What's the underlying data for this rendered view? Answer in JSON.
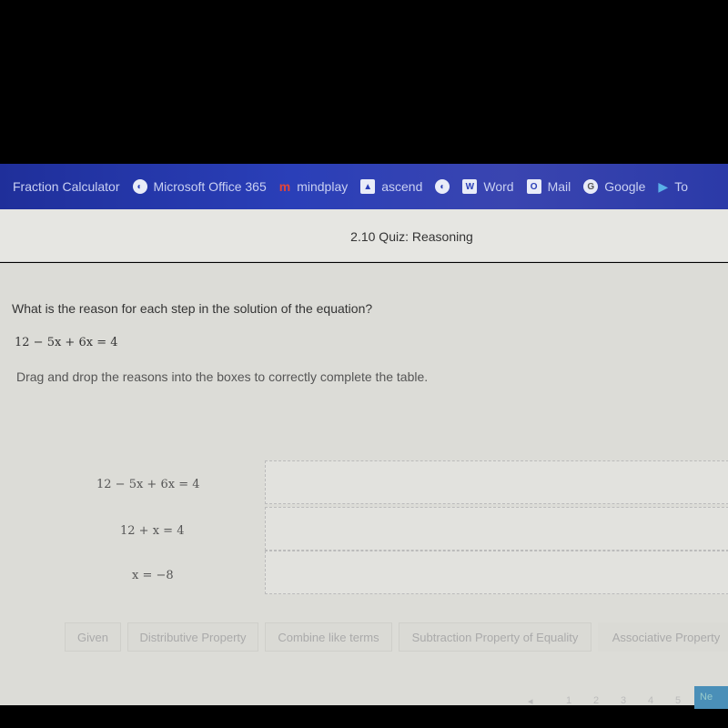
{
  "bookmarks": [
    {
      "label": "Fraction Calculator",
      "icon": ""
    },
    {
      "label": "Microsoft Office 365",
      "icon": "globe-icon"
    },
    {
      "label": "mindplay",
      "icon": "mindplay-icon"
    },
    {
      "label": "ascend",
      "icon": "ascend-icon"
    },
    {
      "label": "",
      "icon": "globe-icon"
    },
    {
      "label": "Word",
      "icon": "word-icon"
    },
    {
      "label": "Mail",
      "icon": "outlook-icon"
    },
    {
      "label": "Google",
      "icon": "google-icon"
    },
    {
      "label": "To",
      "icon": "play-icon"
    }
  ],
  "header": {
    "title": "2.10 Quiz: Reasoning"
  },
  "question": {
    "prompt": "What is the reason for each step in the solution of the equation?",
    "equation": "12 − 5x + 6x = 4",
    "instruction": "Drag and drop the reasons into the boxes to correctly complete the table."
  },
  "steps": [
    "12 − 5x + 6x = 4",
    "12 + x = 4",
    "x = −8"
  ],
  "reasons": [
    "Given",
    "Distributive Property",
    "Combine like terms",
    "Subtraction Property of Equality",
    "Associative Property"
  ],
  "pagination": {
    "pages": [
      "1",
      "2",
      "3",
      "4",
      "5"
    ],
    "prev": "◂",
    "next_label": "Ne"
  }
}
